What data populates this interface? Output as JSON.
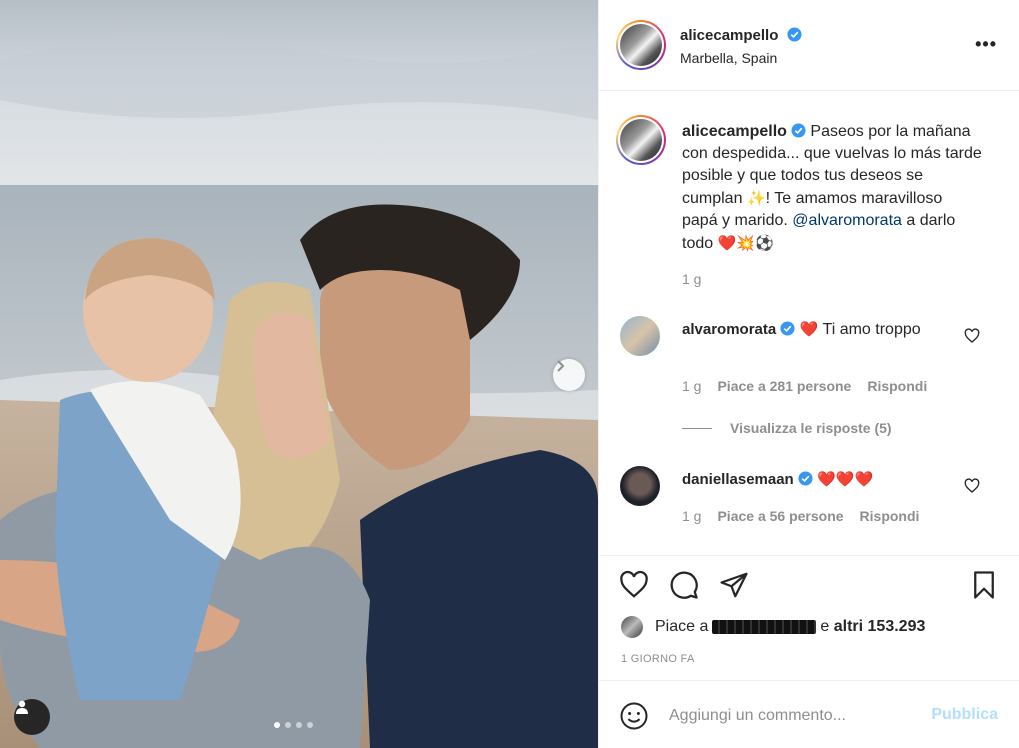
{
  "post": {
    "username": "alicecampello",
    "location": "Marbella, Spain",
    "carousel_count": 4,
    "carousel_active": 1
  },
  "caption": {
    "username": "alicecampello",
    "text": "Paseos por la mañana con despedida... que vuelvas lo más tarde posible y que todos tus deseos se cumplan",
    "sparkle": "✨",
    "text2": "! Te amamos maravilloso papá y marido.",
    "mention": "@alvaromorata",
    "text3": " a darlo todo",
    "emojis": "❤️💥⚽",
    "time": "1 g"
  },
  "comments": [
    {
      "username": "alvaromorata",
      "emoji": "❤️",
      "text": " Ti amo troppo",
      "time": "1 g",
      "likes": "Piace a 281 persone",
      "reply": "Rispondi",
      "view_replies": "Visualizza le risposte (5)"
    },
    {
      "username": "daniellasemaan",
      "emoji": "❤️❤️❤️",
      "text": "",
      "time": "1 g",
      "likes": "Piace a 56 persone",
      "reply": "Rispondi"
    }
  ],
  "likes_line": {
    "prefix": "Piace a",
    "connector": "e",
    "others": "altri 153.293"
  },
  "date": "1 GIORNO FA",
  "add_comment": {
    "placeholder": "Aggiungi un commento...",
    "publish": "Pubblica"
  },
  "colors": {
    "accent": "#0095f6",
    "publish_disabled": "#b2dffc",
    "heart_red": "#ed4956"
  }
}
